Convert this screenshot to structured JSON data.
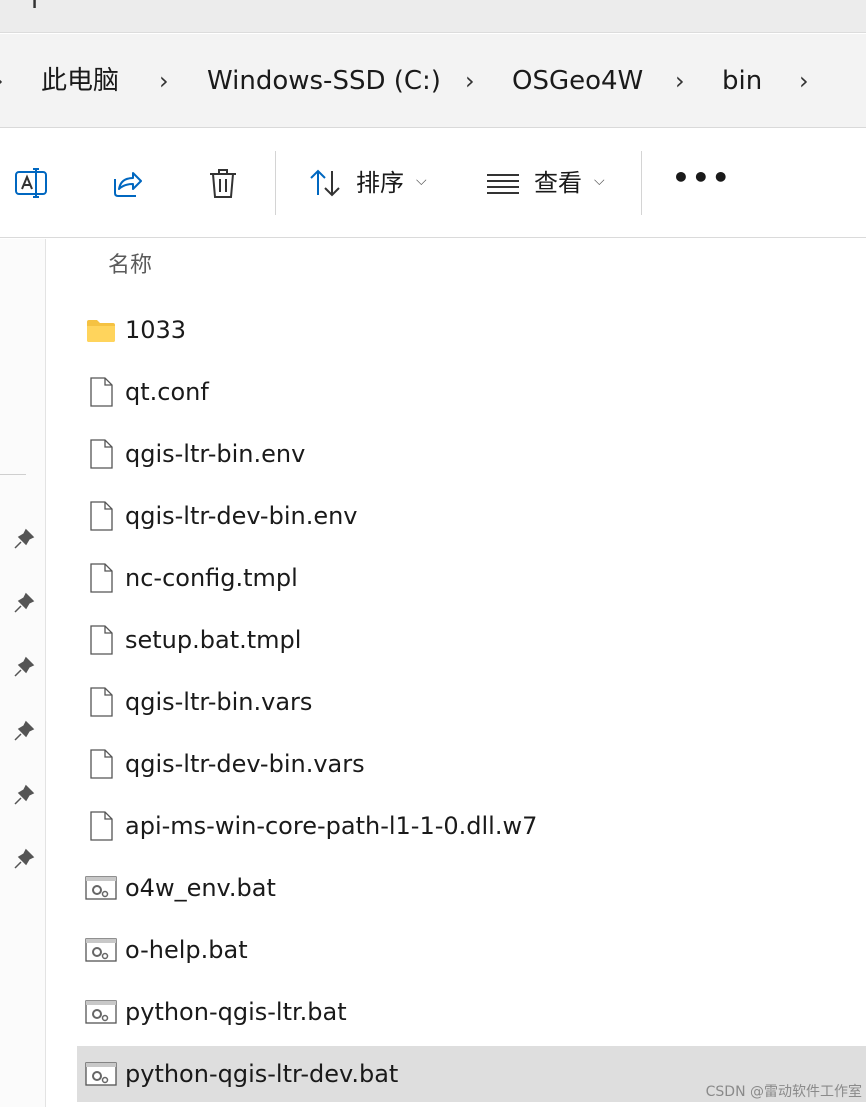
{
  "tabstrip": {
    "new_tab_label": "+"
  },
  "breadcrumb": {
    "items": [
      "此电脑",
      "Windows-SSD (C:)",
      "OSGeo4W",
      "bin"
    ],
    "separator": "›"
  },
  "toolbar": {
    "rename_icon": "rename-icon",
    "share_icon": "share-icon",
    "delete_icon": "trash-icon",
    "sort_label": "排序",
    "view_label": "查看",
    "more_label": "•••"
  },
  "file_list": {
    "column_name": "名称",
    "items": [
      {
        "name": "1033",
        "icon": "folder-icon"
      },
      {
        "name": "qt.conf",
        "icon": "file-icon"
      },
      {
        "name": "qgis-ltr-bin.env",
        "icon": "file-icon"
      },
      {
        "name": "qgis-ltr-dev-bin.env",
        "icon": "file-icon"
      },
      {
        "name": "nc-config.tmpl",
        "icon": "file-icon"
      },
      {
        "name": "setup.bat.tmpl",
        "icon": "file-icon"
      },
      {
        "name": "qgis-ltr-bin.vars",
        "icon": "file-icon"
      },
      {
        "name": "qgis-ltr-dev-bin.vars",
        "icon": "file-icon"
      },
      {
        "name": "api-ms-win-core-path-l1-1-0.dll.w7",
        "icon": "file-icon"
      },
      {
        "name": "o4w_env.bat",
        "icon": "batch-file-icon"
      },
      {
        "name": "o-help.bat",
        "icon": "batch-file-icon"
      },
      {
        "name": "python-qgis-ltr.bat",
        "icon": "batch-file-icon"
      },
      {
        "name": "python-qgis-ltr-dev.bat",
        "icon": "batch-file-icon"
      }
    ],
    "selected_item": "python-qgis-ltr-dev.bat"
  },
  "watermark": "CSDN @雷动软件工作室",
  "colors": {
    "accent": "#0067c0",
    "folder": "#f5c242",
    "selected_row": "#dedede"
  }
}
